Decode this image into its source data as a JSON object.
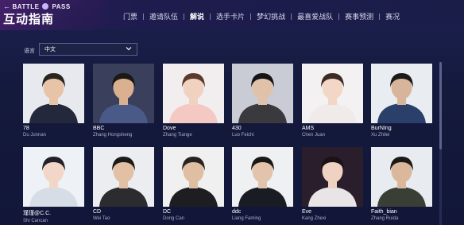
{
  "header": {
    "back_label": "BATTLE",
    "pass_label": "PASS",
    "title": "互动指南",
    "tabs": [
      {
        "label": "门票",
        "active": false
      },
      {
        "label": "邀请队伍",
        "active": false
      },
      {
        "label": "解说",
        "active": true
      },
      {
        "label": "选手卡片",
        "active": false
      },
      {
        "label": "梦幻挑战",
        "active": false
      },
      {
        "label": "最喜爱战队",
        "active": false
      },
      {
        "label": "赛事预测",
        "active": false
      },
      {
        "label": "赛况",
        "active": false
      }
    ]
  },
  "language": {
    "label": "语言",
    "value": "中文"
  },
  "casters": [
    {
      "handle": "78",
      "name": "Du Junnan",
      "bg": "#e8e9ee",
      "shirt": "#23283a",
      "hair": "#2a2420",
      "skin": "#e7c4a8"
    },
    {
      "handle": "BBC",
      "name": "Zhang Hongsheng",
      "bg": "#3a3f5c",
      "shirt": "#4a5a88",
      "hair": "#1c1814",
      "skin": "#d9b090"
    },
    {
      "handle": "Dove",
      "name": "Zhang Tiange",
      "bg": "#f2eef0",
      "shirt": "#f4c9c4",
      "hair": "#5a3a2c",
      "skin": "#f1d2c0"
    },
    {
      "handle": "430",
      "name": "Luo Feichi",
      "bg": "#c9ccd4",
      "shirt": "#3a3a3e",
      "hair": "#141414",
      "skin": "#e0c2aa"
    },
    {
      "handle": "AMS",
      "name": "Chen Juan",
      "bg": "#f4f1f2",
      "shirt": "#f0eaea",
      "hair": "#3c2a24",
      "skin": "#f2d6c6"
    },
    {
      "handle": "BurNIng",
      "name": "Xu Zhilei",
      "bg": "#e9ecf0",
      "shirt": "#2a3f6a",
      "hair": "#1a1a1a",
      "skin": "#d8b59a"
    },
    {
      "handle": "瑾瑾@C.C.",
      "name": "Shi Cancan",
      "bg": "#eef2f6",
      "shirt": "#d7dde6",
      "hair": "#222028",
      "skin": "#f2d7c8"
    },
    {
      "handle": "CD",
      "name": "Wei Tao",
      "bg": "#ecedf0",
      "shirt": "#2c2c30",
      "hair": "#1c1a18",
      "skin": "#e2c0a4"
    },
    {
      "handle": "DC",
      "name": "Dong Can",
      "bg": "#f0f0f0",
      "shirt": "#1e1e22",
      "hair": "#2a2220",
      "skin": "#dfbea2"
    },
    {
      "handle": "ddc",
      "name": "Liang Faming",
      "bg": "#eef0f2",
      "shirt": "#1a1c24",
      "hair": "#1a1816",
      "skin": "#e2c4ac"
    },
    {
      "handle": "Eve",
      "name": "Kang Zhexi",
      "bg": "#2a1e2c",
      "shirt": "#e9e4e6",
      "hair": "#1a1214",
      "skin": "#f0d2c2"
    },
    {
      "handle": "Faith_bian",
      "name": "Zhang Ruida",
      "bg": "#e8ebef",
      "shirt": "#3a3f36",
      "hair": "#1c1a18",
      "skin": "#dbb89c"
    }
  ]
}
